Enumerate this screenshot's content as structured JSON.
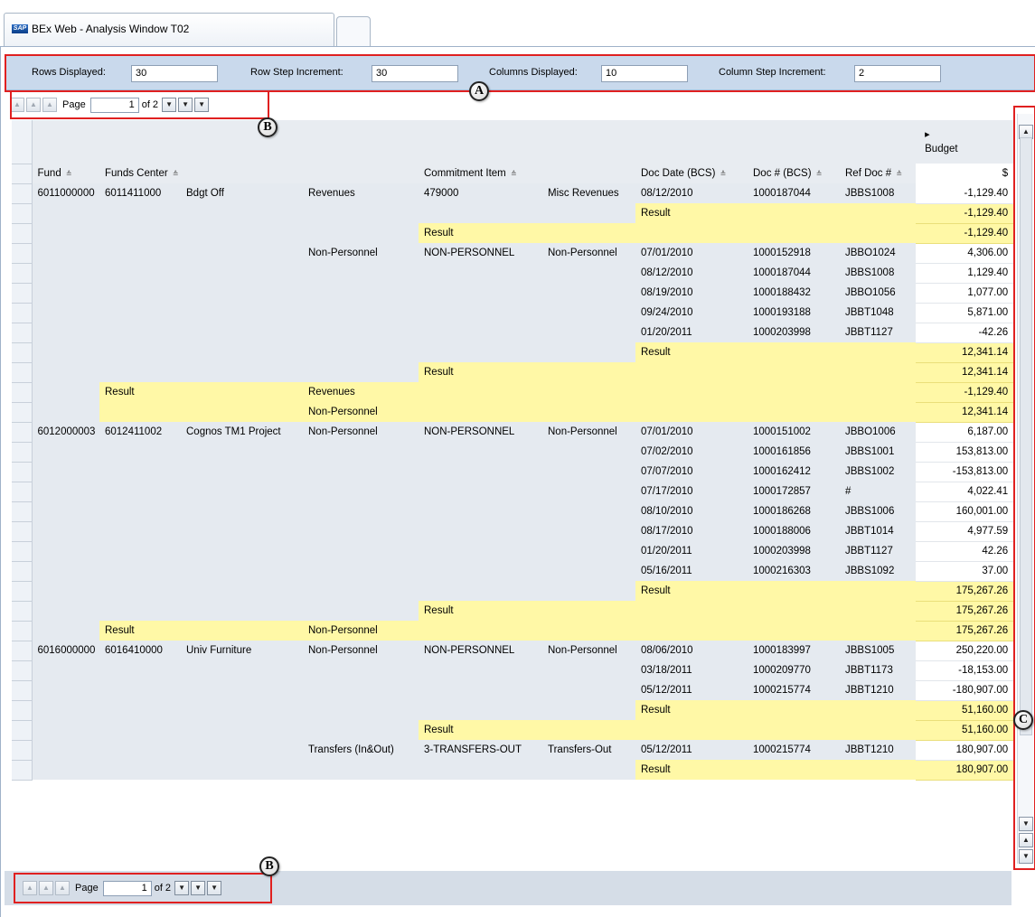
{
  "window": {
    "tab_title": "BEx Web - Analysis Window T02",
    "logo_text": "SAP"
  },
  "settings": {
    "rows_displayed_label": "Rows Displayed:",
    "rows_displayed_value": "30",
    "row_step_label": "Row Step Increment:",
    "row_step_value": "30",
    "columns_displayed_label": "Columns Displayed:",
    "columns_displayed_value": "10",
    "column_step_label": "Column Step Increment:",
    "column_step_value": "2"
  },
  "pager": {
    "page_label": "Page",
    "page_value": "1",
    "of_text": "of 2"
  },
  "callouts": {
    "a": "A",
    "b": "B",
    "c": "C"
  },
  "grid": {
    "budget_header": "Budget",
    "expand_marker": "▸",
    "sort_marker": "≙",
    "headers": {
      "fund": "Fund",
      "funds_center": "Funds Center",
      "commitment_item": "Commitment Item",
      "doc_date": "Doc Date (BCS)",
      "doc_num": "Doc # (BCS)",
      "ref_doc": "Ref Doc #",
      "currency": "$"
    },
    "rows": [
      {
        "c": [
          "6011000000",
          "6011411000",
          "Bdgt Off",
          "Revenues",
          "479000",
          "Misc Revenues",
          "08/12/2010",
          "1000187044",
          "JBBS1008"
        ],
        "v": "-1,129.40",
        "t": "d"
      },
      {
        "c": [
          "",
          "",
          "",
          "",
          "",
          "",
          "Result",
          "",
          ""
        ],
        "v": "-1,129.40",
        "t": "r7"
      },
      {
        "c": [
          "",
          "",
          "",
          "",
          "Result",
          "",
          "",
          "",
          ""
        ],
        "v": "-1,129.40",
        "t": "r5"
      },
      {
        "c": [
          "",
          "",
          "",
          "Non-Personnel",
          "NON-PERSONNEL",
          "Non-Personnel",
          "07/01/2010",
          "1000152918",
          "JBBO1024"
        ],
        "v": "4,306.00",
        "t": "d"
      },
      {
        "c": [
          "",
          "",
          "",
          "",
          "",
          "",
          "08/12/2010",
          "1000187044",
          "JBBS1008"
        ],
        "v": "1,129.40",
        "t": "d"
      },
      {
        "c": [
          "",
          "",
          "",
          "",
          "",
          "",
          "08/19/2010",
          "1000188432",
          "JBBO1056"
        ],
        "v": "1,077.00",
        "t": "d"
      },
      {
        "c": [
          "",
          "",
          "",
          "",
          "",
          "",
          "09/24/2010",
          "1000193188",
          "JBBT1048"
        ],
        "v": "5,871.00",
        "t": "d"
      },
      {
        "c": [
          "",
          "",
          "",
          "",
          "",
          "",
          "01/20/2011",
          "1000203998",
          "JBBT1127"
        ],
        "v": "-42.26",
        "t": "d"
      },
      {
        "c": [
          "",
          "",
          "",
          "",
          "",
          "",
          "Result",
          "",
          ""
        ],
        "v": "12,341.14",
        "t": "r7"
      },
      {
        "c": [
          "",
          "",
          "",
          "",
          "Result",
          "",
          "",
          "",
          ""
        ],
        "v": "12,341.14",
        "t": "r5"
      },
      {
        "c": [
          "",
          "Result",
          "",
          "Revenues",
          "",
          "",
          "",
          "",
          ""
        ],
        "v": "-1,129.40",
        "t": "r2"
      },
      {
        "c": [
          "",
          "",
          "",
          "Non-Personnel",
          "",
          "",
          "",
          "",
          ""
        ],
        "v": "12,341.14",
        "t": "r2b"
      },
      {
        "c": [
          "6012000003",
          "6012411002",
          "Cognos TM1 Project",
          "Non-Personnel",
          "NON-PERSONNEL",
          "Non-Personnel",
          "07/01/2010",
          "1000151002",
          "JBBO1006"
        ],
        "v": "6,187.00",
        "t": "d"
      },
      {
        "c": [
          "",
          "",
          "",
          "",
          "",
          "",
          "07/02/2010",
          "1000161856",
          "JBBS1001"
        ],
        "v": "153,813.00",
        "t": "d"
      },
      {
        "c": [
          "",
          "",
          "",
          "",
          "",
          "",
          "07/07/2010",
          "1000162412",
          "JBBS1002"
        ],
        "v": "-153,813.00",
        "t": "d"
      },
      {
        "c": [
          "",
          "",
          "",
          "",
          "",
          "",
          "07/17/2010",
          "1000172857",
          "#"
        ],
        "v": "4,022.41",
        "t": "d"
      },
      {
        "c": [
          "",
          "",
          "",
          "",
          "",
          "",
          "08/10/2010",
          "1000186268",
          "JBBS1006"
        ],
        "v": "160,001.00",
        "t": "d"
      },
      {
        "c": [
          "",
          "",
          "",
          "",
          "",
          "",
          "08/17/2010",
          "1000188006",
          "JBBT1014"
        ],
        "v": "4,977.59",
        "t": "d"
      },
      {
        "c": [
          "",
          "",
          "",
          "",
          "",
          "",
          "01/20/2011",
          "1000203998",
          "JBBT1127"
        ],
        "v": "42.26",
        "t": "d"
      },
      {
        "c": [
          "",
          "",
          "",
          "",
          "",
          "",
          "05/16/2011",
          "1000216303",
          "JBBS1092"
        ],
        "v": "37.00",
        "t": "d"
      },
      {
        "c": [
          "",
          "",
          "",
          "",
          "",
          "",
          "Result",
          "",
          ""
        ],
        "v": "175,267.26",
        "t": "r7"
      },
      {
        "c": [
          "",
          "",
          "",
          "",
          "Result",
          "",
          "",
          "",
          ""
        ],
        "v": "175,267.26",
        "t": "r5"
      },
      {
        "c": [
          "",
          "Result",
          "",
          "Non-Personnel",
          "",
          "",
          "",
          "",
          ""
        ],
        "v": "175,267.26",
        "t": "r2"
      },
      {
        "c": [
          "6016000000",
          "6016410000",
          "Univ Furniture",
          "Non-Personnel",
          "NON-PERSONNEL",
          "Non-Personnel",
          "08/06/2010",
          "1000183997",
          "JBBS1005"
        ],
        "v": "250,220.00",
        "t": "d"
      },
      {
        "c": [
          "",
          "",
          "",
          "",
          "",
          "",
          "03/18/2011",
          "1000209770",
          "JBBT1173"
        ],
        "v": "-18,153.00",
        "t": "d"
      },
      {
        "c": [
          "",
          "",
          "",
          "",
          "",
          "",
          "05/12/2011",
          "1000215774",
          "JBBT1210"
        ],
        "v": "-180,907.00",
        "t": "d"
      },
      {
        "c": [
          "",
          "",
          "",
          "",
          "",
          "",
          "Result",
          "",
          ""
        ],
        "v": "51,160.00",
        "t": "r7"
      },
      {
        "c": [
          "",
          "",
          "",
          "",
          "Result",
          "",
          "",
          "",
          ""
        ],
        "v": "51,160.00",
        "t": "r5"
      },
      {
        "c": [
          "",
          "",
          "",
          "Transfers (In&Out)",
          "3-TRANSFERS-OUT",
          "Transfers-Out",
          "05/12/2011",
          "1000215774",
          "JBBT1210"
        ],
        "v": "180,907.00",
        "t": "d"
      },
      {
        "c": [
          "",
          "",
          "",
          "",
          "",
          "",
          "Result",
          "",
          ""
        ],
        "v": "180,907.00",
        "t": "r7"
      }
    ]
  }
}
